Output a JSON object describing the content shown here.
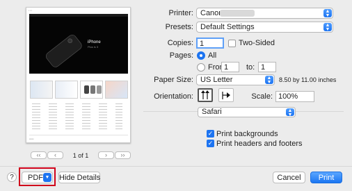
{
  "preview": {
    "hero_title": "iPhone",
    "hero_subtitle": "Plus is 3",
    "nav_first": "‹‹",
    "nav_prev": "‹",
    "page_indicator": "1 of 1",
    "nav_next": "›",
    "nav_last": "››"
  },
  "printer": {
    "label": "Printer:",
    "value": "Canon          series"
  },
  "presets": {
    "label": "Presets:",
    "value": "Default Settings"
  },
  "copies": {
    "label": "Copies:",
    "value": "1",
    "two_sided_label": "Two-Sided",
    "two_sided_checked": false
  },
  "pages": {
    "label": "Pages:",
    "all_label": "All",
    "from_label": "From:",
    "from_value": "1",
    "to_label": "to:",
    "to_value": "1",
    "selected": "All"
  },
  "paper_size": {
    "label": "Paper Size:",
    "value": "US Letter",
    "dimensions": "8.50 by 11.00 inches"
  },
  "orientation": {
    "label": "Orientation:",
    "selected": "portrait"
  },
  "scale": {
    "label": "Scale:",
    "value": "100%"
  },
  "app_menu": {
    "value": "Safari"
  },
  "options": {
    "print_backgrounds": {
      "label": "Print backgrounds",
      "checked": true
    },
    "print_headers_footers": {
      "label": "Print headers and footers",
      "checked": true
    }
  },
  "footer": {
    "help_label": "?",
    "pdf_label": "PDF",
    "hide_details_label": "Hide Details",
    "cancel_label": "Cancel",
    "print_label": "Print"
  },
  "colors": {
    "accent": "#1d74f1",
    "highlight_box": "#d0021b",
    "background": "#ececec"
  }
}
